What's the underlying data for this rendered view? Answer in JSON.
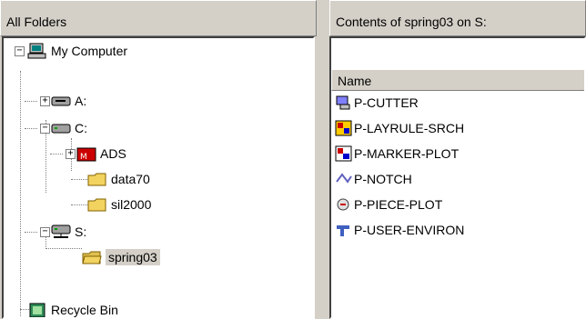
{
  "left_panel": {
    "title": "All Folders"
  },
  "right_panel": {
    "title": "Contents of spring03 on S:"
  },
  "tree": {
    "my_computer": "My Computer",
    "drive_a": "A:",
    "drive_c": "C:",
    "ads": "ADS",
    "data70": "data70",
    "sil2000": "sil2000",
    "drive_s": "S:",
    "spring03": "spring03",
    "recycle_bin": "Recycle Bin"
  },
  "list": {
    "column_name": "Name",
    "items": [
      "P-CUTTER",
      "P-LAYRULE-SRCH",
      "P-MARKER-PLOT",
      "P-NOTCH",
      "P-PIECE-PLOT",
      "P-USER-ENVIRON"
    ]
  },
  "expander_symbols": {
    "expanded": "−",
    "collapsed": "+"
  },
  "colors": {
    "folder": "#f3d35f",
    "selection": "#d4d0c8",
    "drive": "#a0a0a0"
  }
}
